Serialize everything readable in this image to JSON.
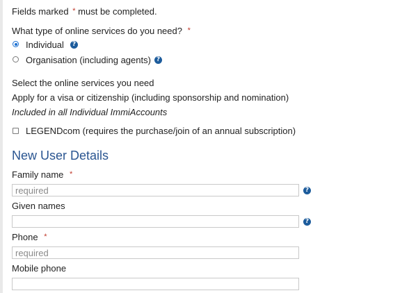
{
  "intro": {
    "text_before": "Fields marked",
    "asterisk": "*",
    "text_after": "must be completed."
  },
  "service_type": {
    "question": "What type of online services do you need?",
    "asterisk": "*",
    "options": [
      {
        "label": "Individual",
        "selected": true
      },
      {
        "label": "Organisation (including agents)",
        "selected": false
      }
    ]
  },
  "services": {
    "heading": "Select the online services you need",
    "apply_line": "Apply for a visa or citizenship (including sponsorship and nomination)",
    "included_note": "Included in all Individual ImmiAccounts",
    "legendcom_label": "LEGENDcom (requires the purchase/join of an annual subscription)",
    "legendcom_checked": false
  },
  "new_user": {
    "heading": "New User Details",
    "fields": {
      "family_name": {
        "label": "Family name",
        "asterisk": "*",
        "placeholder": "required",
        "value": ""
      },
      "given_names": {
        "label": "Given names",
        "placeholder": "",
        "value": ""
      },
      "phone": {
        "label": "Phone",
        "asterisk": "*",
        "placeholder": "required",
        "value": ""
      },
      "mobile_phone": {
        "label": "Mobile phone",
        "placeholder": "",
        "value": ""
      }
    }
  },
  "icons": {
    "help_glyph": "?"
  },
  "colors": {
    "accent": "#2a5591",
    "required": "#c0392b",
    "help_icon": "#1d5c9c",
    "radio_selected": "#1a6fd1"
  }
}
